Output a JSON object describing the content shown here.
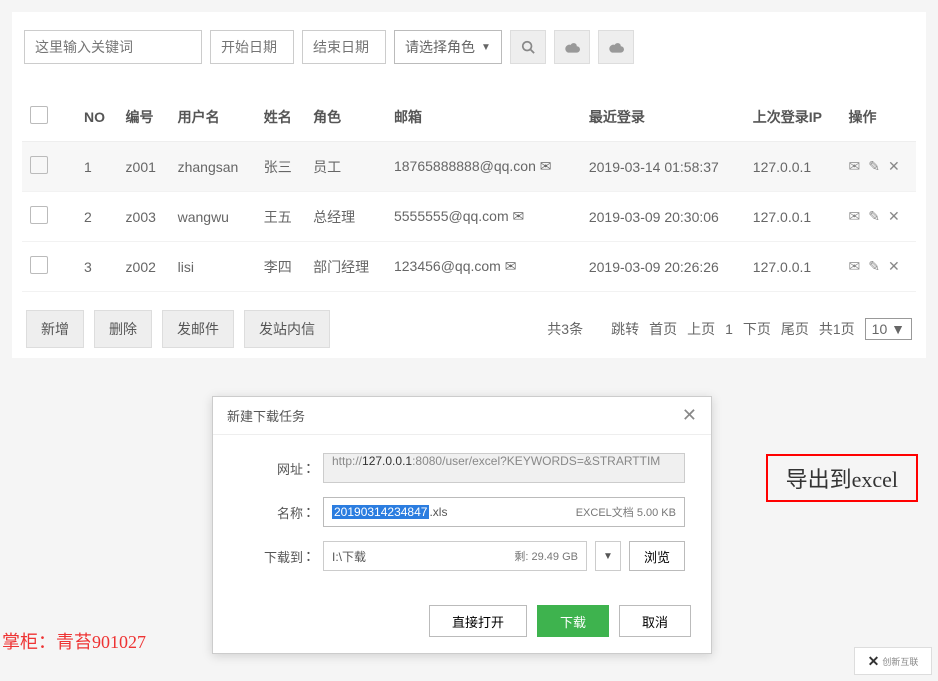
{
  "filters": {
    "keyword_placeholder": "这里输入关键词",
    "start_date_placeholder": "开始日期",
    "end_date_placeholder": "结束日期",
    "role_placeholder": "请选择角色"
  },
  "table": {
    "headers": {
      "no": "NO",
      "code": "编号",
      "username": "用户名",
      "name": "姓名",
      "role": "角色",
      "email": "邮箱",
      "last_login": "最近登录",
      "last_ip": "上次登录IP",
      "ops": "操作"
    },
    "rows": [
      {
        "no": "1",
        "code": "z001",
        "user": "zhangsan",
        "name": "张三",
        "role": "员工",
        "email": "18765888888@qq.con",
        "login": "2019-03-14 01:58:37",
        "ip": "127.0.0.1"
      },
      {
        "no": "2",
        "code": "z003",
        "user": "wangwu",
        "name": "王五",
        "role": "总经理",
        "email": "5555555@qq.com",
        "login": "2019-03-09 20:30:06",
        "ip": "127.0.0.1"
      },
      {
        "no": "3",
        "code": "z002",
        "user": "lisi",
        "name": "李四",
        "role": "部门经理",
        "email": "123456@qq.com",
        "login": "2019-03-09 20:26:26",
        "ip": "127.0.0.1"
      }
    ]
  },
  "actions": {
    "add": "新增",
    "delete": "删除",
    "send_email": "发邮件",
    "send_msg": "发站内信"
  },
  "pager": {
    "summary": "共3条",
    "jump": "跳转",
    "first": "首页",
    "prev": "上页",
    "current": "1",
    "next": "下页",
    "last": "尾页",
    "total_pages": "共1页",
    "size": "10 ▼"
  },
  "dialog": {
    "title": "新建下载任务",
    "url_label": "网址",
    "url_prefix": "http://",
    "url_host": "127.0.0.1",
    "url_rest": ":8080/user/excel?KEYWORDS=&STRARTTIM",
    "name_label": "名称",
    "name_selected": "20190314234847",
    "name_ext": ".xls",
    "name_meta": "EXCEL文档 5.00 KB",
    "dl_label": "下载到",
    "dl_path": "I:\\下载",
    "dl_free": "剩: 29.49 GB",
    "browse": "浏览",
    "open": "直接打开",
    "download": "下载",
    "cancel": "取消"
  },
  "callout": {
    "cn": "导出到",
    "en": "excel"
  },
  "author_label": "掌柜：青苔901027",
  "logo_text": "创新互联"
}
